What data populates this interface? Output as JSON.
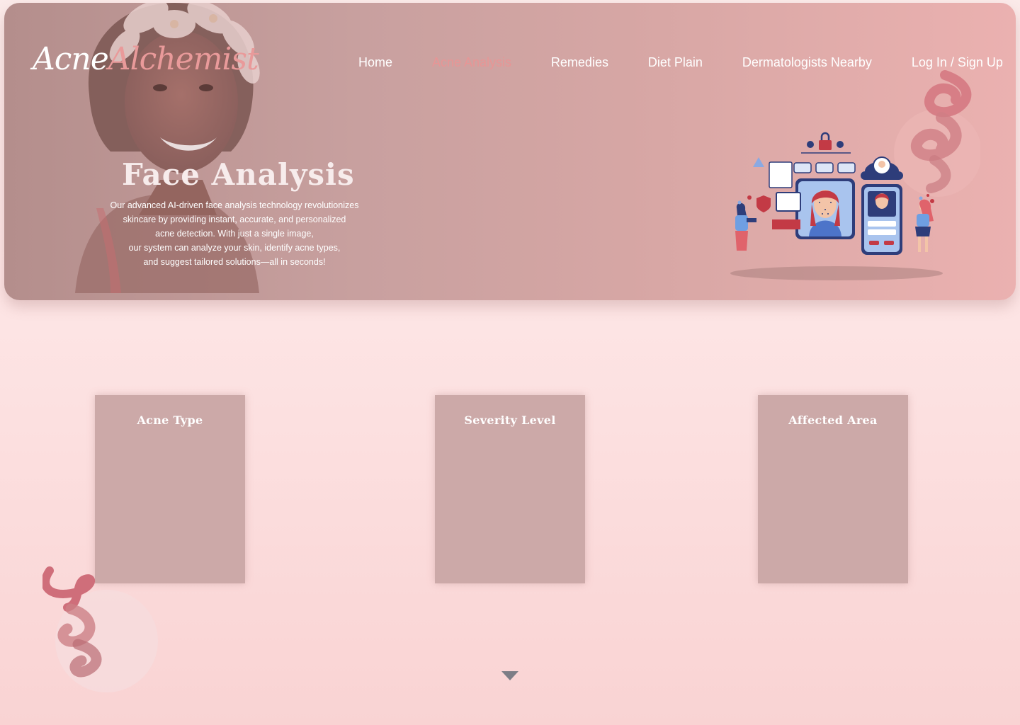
{
  "brand": {
    "part1": "Acne",
    "part2": "Alchemist"
  },
  "nav": {
    "items": [
      {
        "label": "Home"
      },
      {
        "label": "Acne Analysis"
      },
      {
        "label": "Remedies"
      },
      {
        "label": "Diet Plain"
      },
      {
        "label": "Dermatologists Nearby"
      },
      {
        "label": "Log In / Sign Up"
      }
    ],
    "active_index": 1
  },
  "hero": {
    "title": "Face Analysis",
    "description_lines": [
      "Our advanced AI-driven face analysis technology revolutionizes",
      "skincare by providing instant, accurate, and personalized",
      "acne detection. With just a single image,",
      "our system can analyze your skin, identify acne types,",
      "and suggest tailored solutions—all in seconds!"
    ]
  },
  "cards": [
    {
      "title": "Acne Type"
    },
    {
      "title": "Severity Level"
    },
    {
      "title": "Affected Area"
    }
  ],
  "colors": {
    "accent": "#e89595",
    "card_bg": "#cca9a8",
    "hero_left": "#b48e8c",
    "hero_right": "#ebb1b0",
    "arrow": "#7d7d86"
  },
  "icons": {
    "scroll": "triangle-down-icon",
    "illustration": "face-recognition-illustration"
  }
}
